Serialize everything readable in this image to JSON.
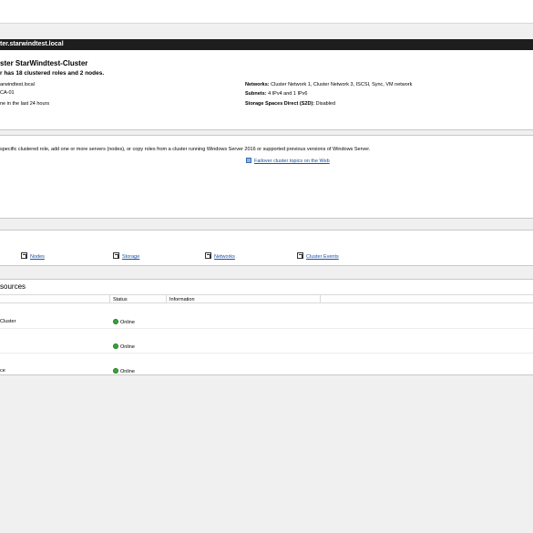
{
  "title_bar": {
    "text": "ter.starwindtest.local"
  },
  "summary": {
    "heading": "ster StarWindtest-Cluster",
    "subheading": "r has 18 clustered roles and 2 nodes.",
    "lines": [
      "arwindtest.local",
      "CA-01",
      "ne in the last 24 hours"
    ],
    "networks_label": "Networks:",
    "networks_value": "Cluster Network 1, Cluster Network 3, ISCSI, Sync, VM network",
    "subnets_label": "Subnets:",
    "subnets_value": "4 IPv4 and 1 IPv6",
    "s2d_label": "Storage Spaces Direct (S2D):",
    "s2d_value": "Disabled"
  },
  "configure": {
    "description": "specific clustered role, add one or more servers (nodes), or copy roles from a cluster running Windows Server 2016 or supported previous versions of Windows Server.",
    "web_link": "Failover cluster topics on the Web"
  },
  "navigate": {
    "links": [
      "Nodes",
      "Storage",
      "Networks",
      "Cluster Events"
    ]
  },
  "resources": {
    "title": "sources",
    "columns": [
      "Status",
      "Information"
    ],
    "rows": [
      {
        "name": "Cluster",
        "status": "Online"
      },
      {
        "name": "",
        "status": "Online"
      },
      {
        "name": "ce",
        "status": "Online"
      }
    ]
  },
  "colors": {
    "title_bar_bg": "#1e1e1e",
    "link": "#1a4fa3",
    "online": "#3aa33a"
  }
}
